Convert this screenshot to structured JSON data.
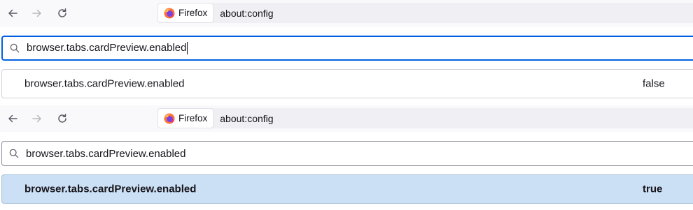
{
  "colors": {
    "accent": "#0061e0",
    "modified_row": "#cce0f5",
    "toolbar_bg": "#f9f9fb",
    "urlbar_bg": "#f0f0f4"
  },
  "icons": {
    "back": "arrow-left-icon",
    "forward": "arrow-right-icon",
    "reload": "reload-icon",
    "identity": "firefox-logo-icon",
    "search": "magnifier-icon"
  },
  "top_panel": {
    "identity_label": "Firefox",
    "url": "about:config",
    "search_value": "browser.tabs.cardPreview.enabled",
    "pref": {
      "name": "browser.tabs.cardPreview.enabled",
      "value": "false",
      "modified": false
    }
  },
  "bottom_panel": {
    "identity_label": "Firefox",
    "url": "about:config",
    "search_value": "browser.tabs.cardPreview.enabled",
    "pref": {
      "name": "browser.tabs.cardPreview.enabled",
      "value": "true",
      "modified": true
    }
  }
}
